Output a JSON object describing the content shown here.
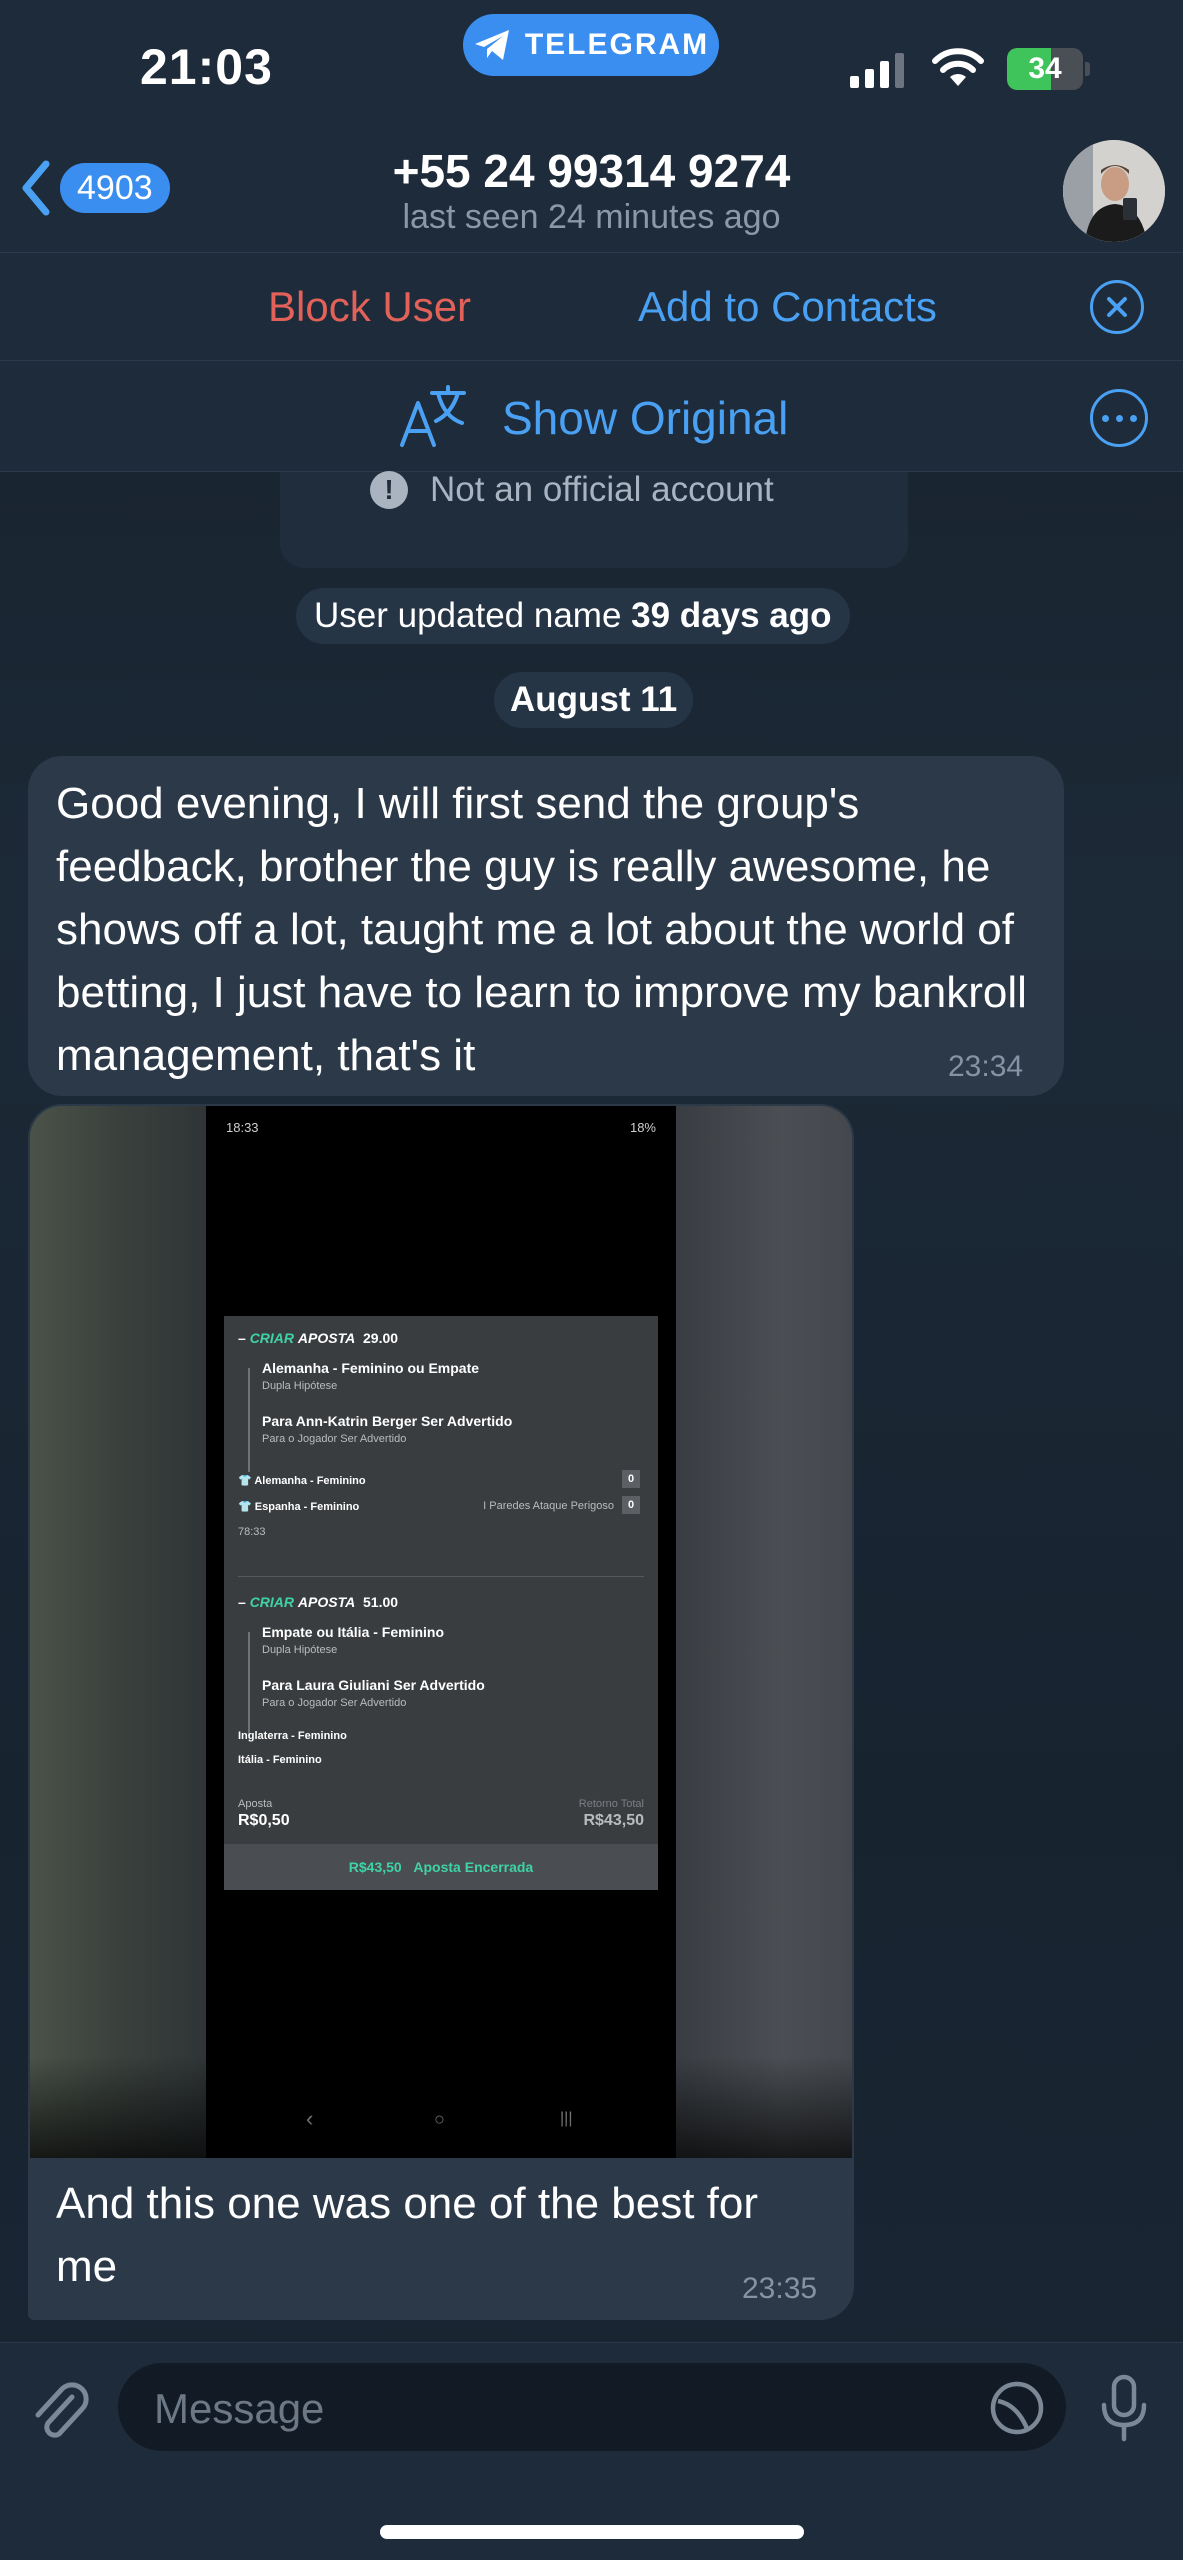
{
  "status_bar": {
    "time": "21:03",
    "app_pill": "TELEGRAM",
    "battery": "34",
    "battery_level_percent": 34
  },
  "header": {
    "back_badge": "4903",
    "title": "+55 24 99314 9274",
    "subtitle": "last seen 24 minutes ago"
  },
  "actions": {
    "block_label": "Block User",
    "add_contacts_label": "Add to Contacts",
    "show_original_label": "Show Original"
  },
  "info": {
    "not_official": "Not an official account"
  },
  "service": {
    "name_update_prefix": "User updated name",
    "name_update_when": "39 days ago",
    "date_divider": "August 11"
  },
  "messages": [
    {
      "text": "Good evening, I will first send the group's feedback, brother the guy is really awesome, he shows off a lot, taught me a lot about the world of betting, I just have to learn to improve my bankroll management, that's it",
      "time": "23:34"
    },
    {
      "text": "And this one was one of the best for me",
      "time": "23:35",
      "photo": {
        "status_time": "18:33",
        "status_right": "18%",
        "bet1": {
          "label_green": "CRIAR",
          "label_white": "APOSTA",
          "odds": "29.00",
          "selections": [
            {
              "title": "Alemanha - Feminino ou Empate",
              "sub": "Dupla Hipótese"
            },
            {
              "title": "Para Ann-Katrin Berger Ser Advertido",
              "sub": "Para o Jogador Ser Advertido"
            }
          ],
          "team1": "Alemanha - Feminino",
          "team1_score": "0",
          "team2": "Espanha - Feminino",
          "team2_score": "0",
          "event_note": "I Paredes Ataque Perigoso",
          "minute": "78:33"
        },
        "bet2": {
          "label_green": "CRIAR",
          "label_white": "APOSTA",
          "odds": "51.00",
          "selections": [
            {
              "title": "Empate ou Itália - Feminino",
              "sub": "Dupla Hipótese"
            },
            {
              "title": "Para Laura Giuliani Ser Advertido",
              "sub": "Para o Jogador Ser Advertido"
            }
          ],
          "team1": "Inglaterra - Feminino",
          "team2": "Itália - Feminino",
          "stake_label": "Aposta",
          "stake_value": "R$0,50",
          "return_label": "Retorno Total",
          "return_value": "R$43,50",
          "closed_amount": "R$43,50",
          "closed_label": "Aposta Encerrada"
        }
      }
    }
  ],
  "composer": {
    "placeholder": "Message"
  },
  "colors": {
    "accent": "#4aa1f3",
    "danger": "#e2625a",
    "bubble": "#2b3949",
    "background": "#1b2633",
    "bet_green": "#3fd3a4"
  },
  "icons": [
    "telegram-plane-icon",
    "chevron-left-icon",
    "close-circle-icon",
    "translate-icon",
    "more-icon",
    "info-icon",
    "paperclip-icon",
    "sticker-icon",
    "microphone-icon"
  ]
}
